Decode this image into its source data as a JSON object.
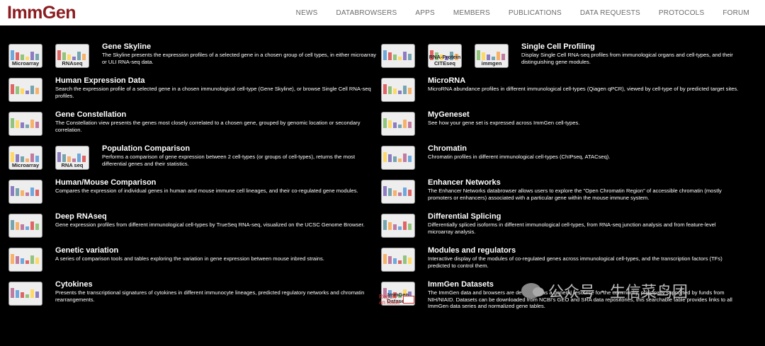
{
  "brand": {
    "logo": "ImmGen"
  },
  "nav": [
    "NEWS",
    "DATABROWSERS",
    "APPS",
    "MEMBERS",
    "PUBLICATIONS",
    "DATA REQUESTS",
    "PROTOCOLS",
    "FORUM"
  ],
  "left": [
    {
      "title": "Gene Skyline",
      "desc": "The Skyline presents the expression profiles of a selected gene in a chosen group of cell types, in either microarray or ULI RNA-seq data.",
      "thumbs": [
        "Microarray",
        "RNAseq"
      ]
    },
    {
      "title": "Human Expression Data",
      "desc": "Search the expression profile of a selected gene in a chosen immunological cell-type (Gene Skyline), or browse Single Cell RNA-seq profiles.",
      "thumbs": [
        ""
      ]
    },
    {
      "title": "Gene Constellation",
      "desc": "The Constellation view presents the genes most closely correlated to a chosen gene, grouped by genomic location or secondary correlation.",
      "thumbs": [
        ""
      ]
    },
    {
      "title": "Population Comparison",
      "desc": "Performs a comparison of gene expression between 2 cell-types (or groups of cell-types), returns the most differential genes and their statistics.",
      "thumbs": [
        "Microarray",
        "RNA seq"
      ]
    },
    {
      "title": "Human/Mouse Comparison",
      "desc": "Compares the expression of individual genes in human and mouse immune cell lineages, and their co-regulated gene modules.",
      "thumbs": [
        ""
      ]
    },
    {
      "title": "Deep RNAseq",
      "desc": "Gene expression profiles from different immunological cell-types by TrueSeq RNA-seq, visualized on the UCSC Genome Browser.",
      "thumbs": [
        ""
      ]
    },
    {
      "title": "Genetic variation",
      "desc": "A series of comparison tools and tables exploring the variation in gene expression between mouse inbred strains.",
      "thumbs": [
        ""
      ]
    },
    {
      "title": "Cytokines",
      "desc": "Presents the transcriptional signatures of cytokines in different immunocyte lineages, predicted regulatory networks and chromatin rearrangements.",
      "thumbs": [
        ""
      ]
    }
  ],
  "right": [
    {
      "title": "Single Cell Profiling",
      "desc": "Display Single Cell RNA-seq profiles from immunological organs and cell-types, and their distinguishing gene modules.",
      "thumbs": [
        "",
        "RNA-Protein CITEseq",
        "immgen"
      ]
    },
    {
      "title": "MicroRNA",
      "desc": "MicroRNA abundance profiles in different immunological cell-types (Qiagen qPCR), viewed by cell-type of by predicted target sites.",
      "thumbs": [
        ""
      ]
    },
    {
      "title": "MyGeneset",
      "desc": "See how your gene set is expressed across ImmGen cell-types.",
      "thumbs": [
        ""
      ]
    },
    {
      "title": "Chromatin",
      "desc": "Chromatin profiles in different immunological cell-types (ChIPseq, ATACseq).",
      "thumbs": [
        ""
      ]
    },
    {
      "title": "Enhancer Networks",
      "desc": "The Enhancer Networks databrowser allows users to explore the \"Open Chromatin Region\" of accessible chromatin (mostly promoters or enhancers) associated with a particular gene within the mouse immune system.",
      "thumbs": [
        ""
      ]
    },
    {
      "title": "Differential Splicing",
      "desc": "Differentially spliced isoforms in different immunological cell-types, from RNA-seq junction analysis and from feature-level microarray analysis.",
      "thumbs": [
        ""
      ]
    },
    {
      "title": "Modules and regulators",
      "desc": "Interactive display of the modules of co-regulated genes across immunological cell-types, and the transcription factors (TFs) predicted to control them.",
      "thumbs": [
        ""
      ]
    },
    {
      "title": "ImmGen Datasets",
      "desc": "The ImmGen data and browsers are developed as a general resource for the community, principally supported by funds from NIH/NIAID. Datasets can be downloaded from NCBI's GEO and SRA data repositories, this searchable table provides links to all ImmGen data series and normalized gene tables.",
      "thumbs": [
        "ImmGen Datasets"
      ]
    }
  ],
  "report": {
    "line1": "Report",
    "line2": "an issue"
  },
  "watermark": "公众号 · 生信菜鸟团"
}
